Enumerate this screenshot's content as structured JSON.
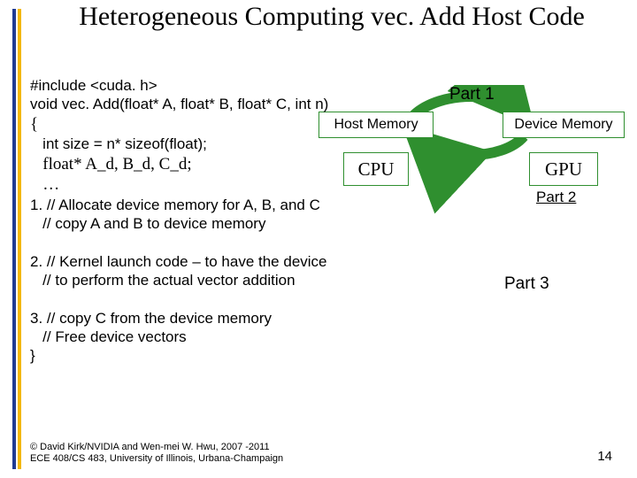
{
  "title": "Heterogeneous Computing vec. Add Host Code",
  "diagram": {
    "part1": "Part 1",
    "part2": "Part 2",
    "part3": "Part 3",
    "host_mem": "Host Memory",
    "device_mem": "Device Memory",
    "cpu": "CPU",
    "gpu": "GPU"
  },
  "code": {
    "l1": "#include <cuda. h>",
    "l2": "void vec. Add(float* A, float* B, float* C, int n)",
    "l3": "{",
    "l4": "   int size = n* sizeof(float);",
    "l5": "   float* A_d, B_d, C_d;",
    "l6": "   …",
    "l7": "1. // Allocate device memory for A, B, and C",
    "l8": "   // copy A and B to device memory",
    "gap1": " ",
    "l9": "2. // Kernel launch code – to have the device",
    "l10": "   // to perform the actual vector addition",
    "gap2": " ",
    "l11": "3. // copy C from the device memory",
    "l12": "   // Free device vectors",
    "l13": "}"
  },
  "footer": {
    "l1": "© David Kirk/NVIDIA and Wen-mei W. Hwu, 2007 -2011",
    "l2": "ECE 408/CS 483, University of Illinois, Urbana-Champaign"
  },
  "page_number": "14"
}
